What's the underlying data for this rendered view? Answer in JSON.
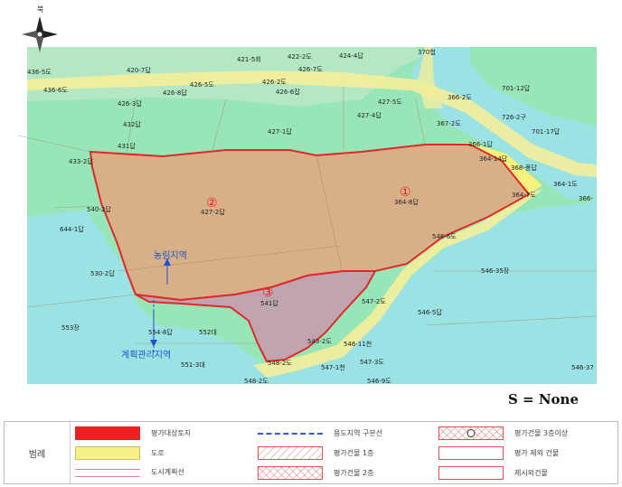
{
  "map": {
    "north_label": "북",
    "parcel_labels": [
      "436-5도",
      "420-7답",
      "421-5회",
      "422-2도",
      "424-4답",
      "370헙",
      "426-7도",
      "426-2도",
      "426-5도",
      "426-6잡",
      "426-8답",
      "426-3답",
      "701-12답",
      "436-6도",
      "427-5도",
      "366-2도",
      "432답",
      "427-4답",
      "726-2구",
      "367-2도",
      "701-17답",
      "427-1답",
      "431답",
      "366-1답",
      "433-2답",
      "364-14답",
      "368-풍답",
      "364-1도",
      "366-",
      "540-2답",
      "427-2답",
      "364-8답",
      "364-7도",
      "644-1답",
      "546-6도",
      "530-2답",
      "546-35장",
      "541답",
      "547-2도",
      "546-5답",
      "553장",
      "554-8답",
      "552대",
      "543-2도",
      "546-11천",
      "551-3대",
      "548-2도",
      "547-3도",
      "547-1천",
      "546-37",
      "548-2도",
      "546-9도"
    ],
    "circle_labels": [
      "①",
      "②",
      "③"
    ],
    "zone_labels": [
      "농림지역",
      "계획관리지역"
    ],
    "colors": {
      "land_green": "#98e6b8",
      "water_cyan": "#9ae2e4",
      "road_yellow": "#f6f0a0",
      "parcel_tan": "#d8b088",
      "parcel_mauve": "#c0a4b0",
      "boundary_red": "#e02828"
    }
  },
  "scale_text": "S = None",
  "legend": {
    "title": "범례",
    "items": [
      {
        "label": "평가대상토지",
        "swatch": "solid-red"
      },
      {
        "label": "용도지역 구분선",
        "swatch": "dashed-blue"
      },
      {
        "label": "평가건물 3층이상",
        "swatch": "hatch-circle"
      },
      {
        "label": "도로",
        "swatch": "solid-yellow"
      },
      {
        "label": "평가건물 1층",
        "swatch": "hatch-single"
      },
      {
        "label": "평가 제외 건물",
        "swatch": "outline-red"
      },
      {
        "label": "도시계획선",
        "swatch": "lines-pink"
      },
      {
        "label": "평가건물 2층",
        "swatch": "hatch-cross"
      },
      {
        "label": "제시외건물",
        "swatch": "outline-red"
      }
    ]
  }
}
